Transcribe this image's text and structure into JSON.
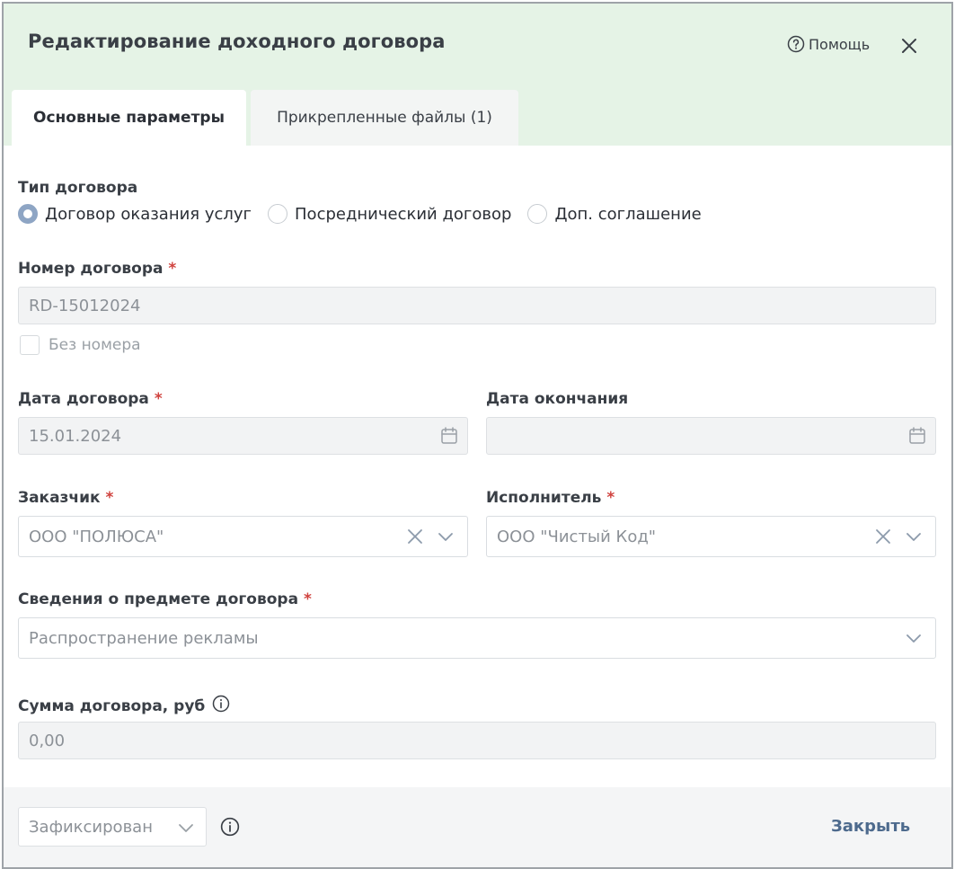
{
  "dialog": {
    "title": "Редактирование доходного договора",
    "help_label": "Помощь",
    "close_icon": "close-icon"
  },
  "tabs": [
    {
      "label": "Основные параметры",
      "active": true
    },
    {
      "label": "Прикрепленные файлы (1)",
      "active": false
    }
  ],
  "contract_type": {
    "label": "Тип договора",
    "options": [
      {
        "label": "Договор оказания услуг",
        "selected": true
      },
      {
        "label": "Посреднический договор",
        "selected": false
      },
      {
        "label": "Доп. соглашение",
        "selected": false
      }
    ]
  },
  "contract_number": {
    "label": "Номер договора",
    "required_mark": "*",
    "value": "RD-15012024",
    "no_number_label": "Без номера",
    "no_number_checked": false
  },
  "contract_date": {
    "label": "Дата договора",
    "required_mark": "*",
    "value": "15.01.2024"
  },
  "end_date": {
    "label": "Дата окончания",
    "value": ""
  },
  "customer": {
    "label": "Заказчик",
    "required_mark": "*",
    "value": "ООО \"ПОЛЮСА\""
  },
  "executor": {
    "label": "Исполнитель",
    "required_mark": "*",
    "value": "ООО \"Чистый Код\""
  },
  "subject": {
    "label": "Сведения о предмете договора",
    "required_mark": "*",
    "value": "Распространение рекламы"
  },
  "amount": {
    "label": "Сумма договора, руб",
    "value": "0,00"
  },
  "footer": {
    "status_value": "Зафиксирован",
    "close_label": "Закрыть"
  },
  "colors": {
    "header_bg": "#e5f3e6",
    "required": "#d0423e",
    "close_button": "#4d6a8d",
    "radio_selected": "#8ea5c4"
  }
}
